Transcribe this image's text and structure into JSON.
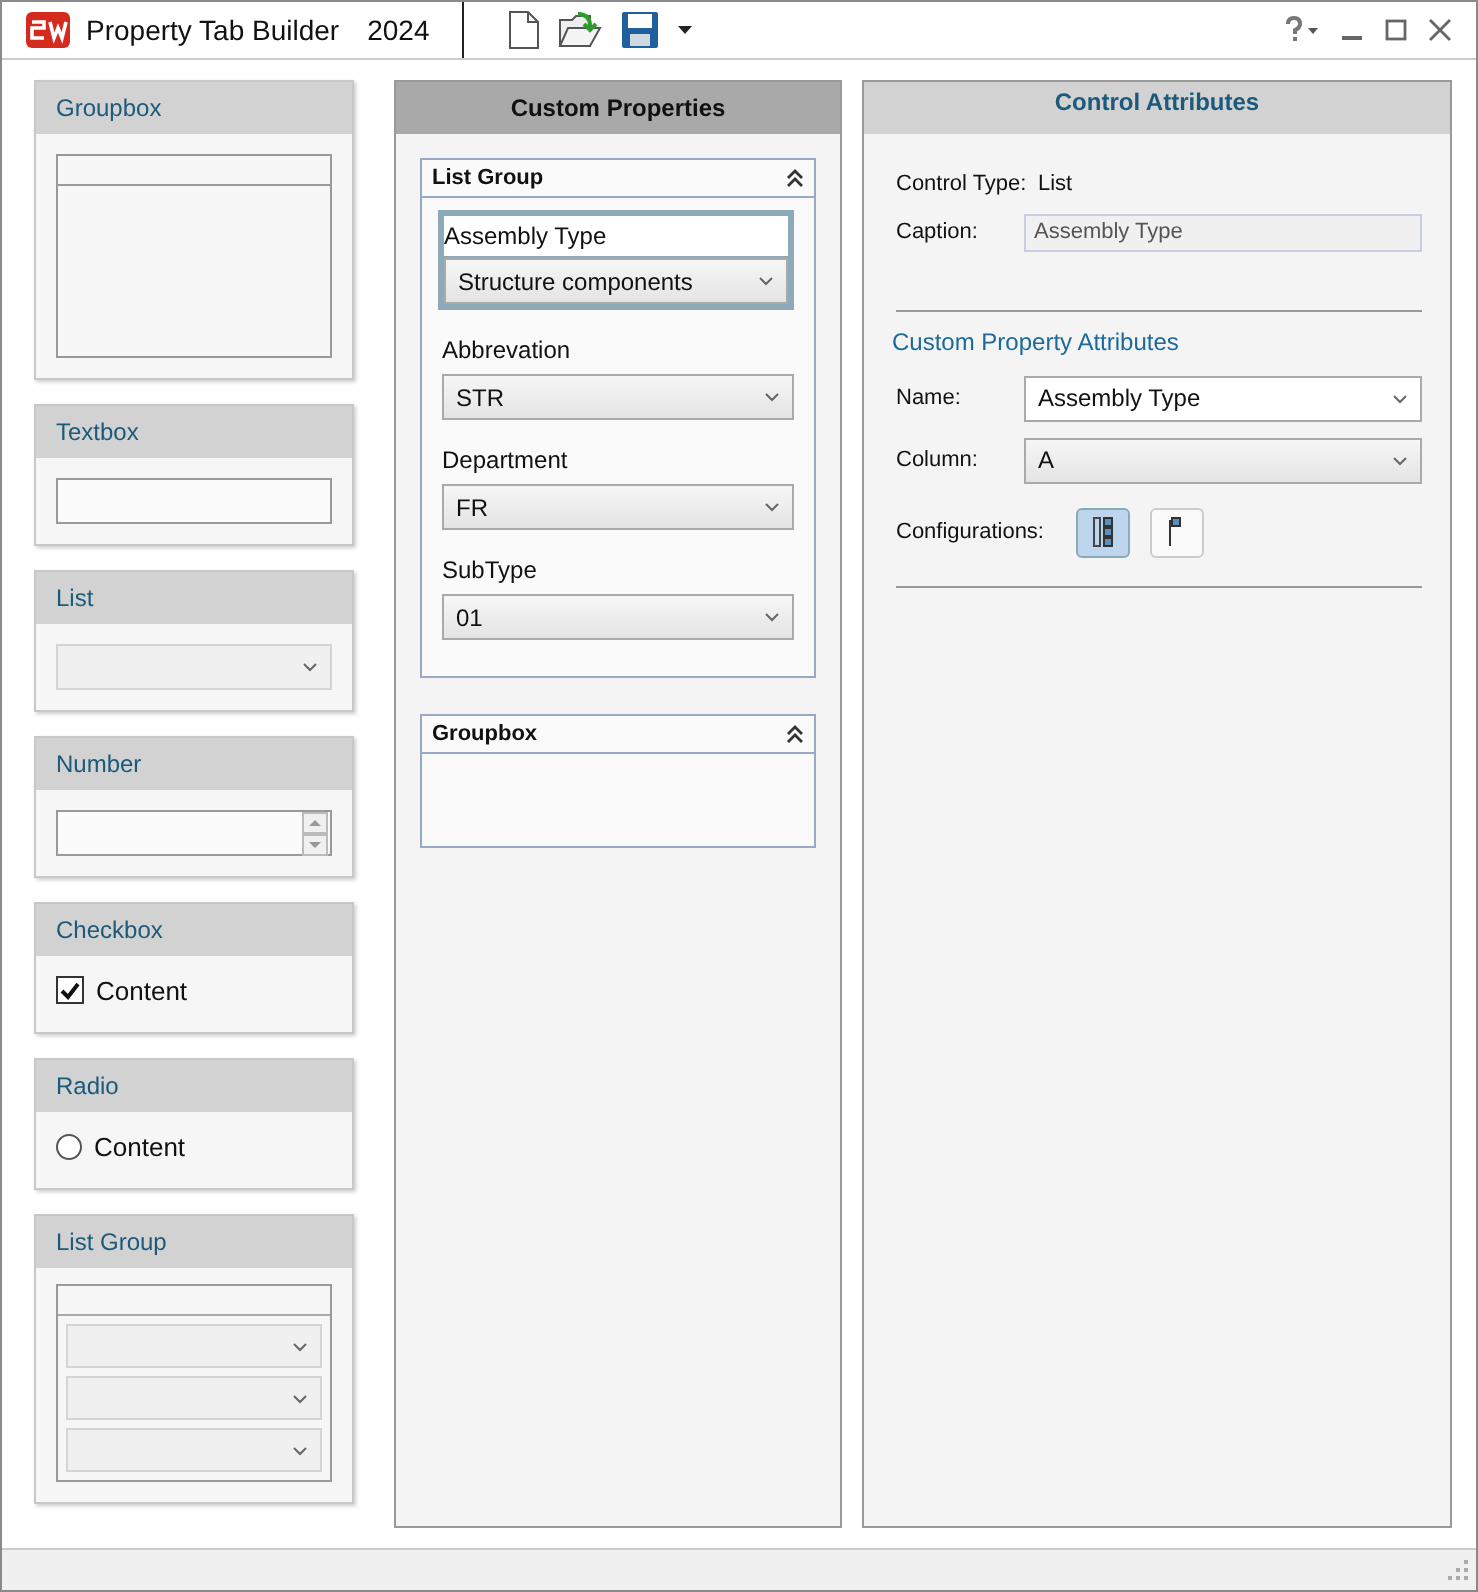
{
  "window": {
    "title": "Property Tab Builder",
    "version": "2024"
  },
  "palette": [
    {
      "kind": "groupbox",
      "title": "Groupbox"
    },
    {
      "kind": "textbox",
      "title": "Textbox"
    },
    {
      "kind": "list",
      "title": "List"
    },
    {
      "kind": "number",
      "title": "Number"
    },
    {
      "kind": "checkbox",
      "title": "Checkbox",
      "label": "Content",
      "checked": true
    },
    {
      "kind": "radio",
      "title": "Radio",
      "label": "Content",
      "selected": false
    },
    {
      "kind": "listgroup",
      "title": "List Group"
    }
  ],
  "custom_properties": {
    "title": "Custom Properties",
    "groups": [
      {
        "kind": "listgroup",
        "title": "List Group",
        "fields": [
          {
            "label": "Assembly Type",
            "value": "Structure components",
            "selected": true
          },
          {
            "label": "Abbrevation",
            "value": "STR",
            "selected": false
          },
          {
            "label": "Department",
            "value": "FR",
            "selected": false
          },
          {
            "label": "SubType",
            "value": "01",
            "selected": false
          }
        ]
      },
      {
        "kind": "groupbox",
        "title": "Groupbox"
      }
    ]
  },
  "control_attributes": {
    "title": "Control Attributes",
    "control_type": {
      "label": "Control Type:",
      "value": "List"
    },
    "caption": {
      "label": "Caption:",
      "value": "Assembly Type"
    },
    "section_title": "Custom Property Attributes",
    "name": {
      "label": "Name:",
      "value": "Assembly Type"
    },
    "column": {
      "label": "Column:",
      "value": "A"
    },
    "configurations": {
      "label": "Configurations:",
      "buttons": [
        {
          "selected": true
        },
        {
          "selected": false
        }
      ]
    }
  }
}
